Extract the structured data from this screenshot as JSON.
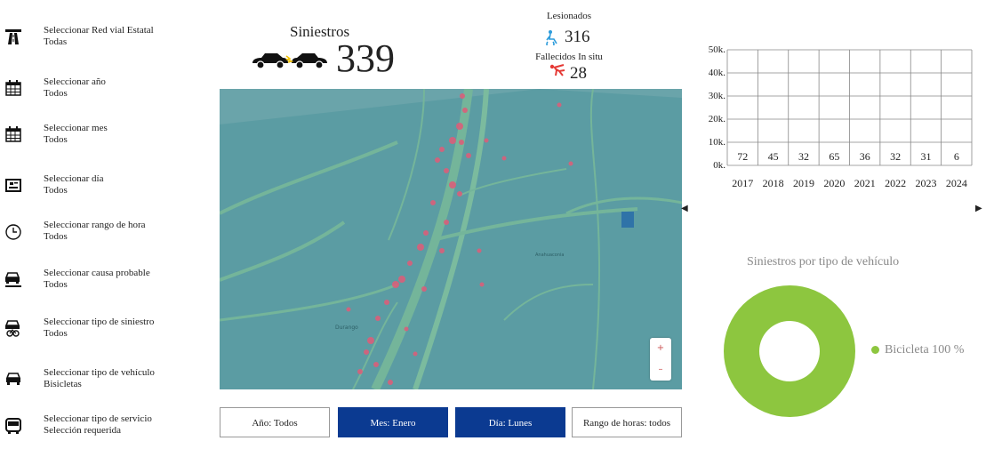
{
  "filters": [
    {
      "title": "Seleccionar Red vial Estatal",
      "value": "Todas",
      "icon": "highway-icon"
    },
    {
      "title": "Seleccionar año",
      "value": "Todos",
      "icon": "calendar-icon"
    },
    {
      "title": "Seleccionar mes",
      "value": "Todos",
      "icon": "calendar-icon"
    },
    {
      "title": "Seleccionar día",
      "value": "Todos",
      "icon": "day-card-icon"
    },
    {
      "title": "Seleccionar rango de hora",
      "value": "Todos",
      "icon": "clock-icon"
    },
    {
      "title": "Seleccionar causa probable",
      "value": "Todos",
      "icon": "car-crash-icon"
    },
    {
      "title": "Seleccionar tipo de siniestro",
      "value": "Todos",
      "icon": "car-bike-icon"
    },
    {
      "title": "Seleccionar tipo de vehículo",
      "value": "Bisicletas",
      "icon": "vehicle-icon"
    },
    {
      "title": "Seleccionar tipo de servicio",
      "value": "Selección requerida",
      "icon": "bus-icon"
    }
  ],
  "kpi": {
    "siniestros_label": "Siniestros",
    "siniestros_value": "339",
    "lesionados_label": "Lesionados",
    "lesionados_value": "316",
    "fallecidos_label": "Fallecidos In situ",
    "fallecidos_value": "28"
  },
  "map": {
    "zoom_in": "+",
    "zoom_out": "–"
  },
  "tags": {
    "year": "Año: Todos",
    "month": "Mes: Enero",
    "day": "Día: Lunes",
    "hours": "Rango de horas: todos"
  },
  "colors": {
    "accent": "#0b3a91",
    "donut": "#8dc63f",
    "danger": "#e53935",
    "injured": "#2d9cdb"
  },
  "chart_data": [
    {
      "type": "table",
      "categories": [
        "2017",
        "2018",
        "2019",
        "2020",
        "2021",
        "2022",
        "2023",
        "2024"
      ],
      "values": [
        72,
        45,
        32,
        65,
        36,
        32,
        31,
        6
      ],
      "yticks": [
        "0k.",
        "10k.",
        "20k.",
        "30k.",
        "40k.",
        "50k."
      ],
      "ylim": [
        0,
        50000
      ],
      "grid": true
    },
    {
      "type": "pie",
      "title": "Siniestros por tipo de vehículo",
      "labels": [
        "Bicicleta"
      ],
      "values": [
        100
      ],
      "legend_text": "Bicicleta 100 %"
    }
  ]
}
